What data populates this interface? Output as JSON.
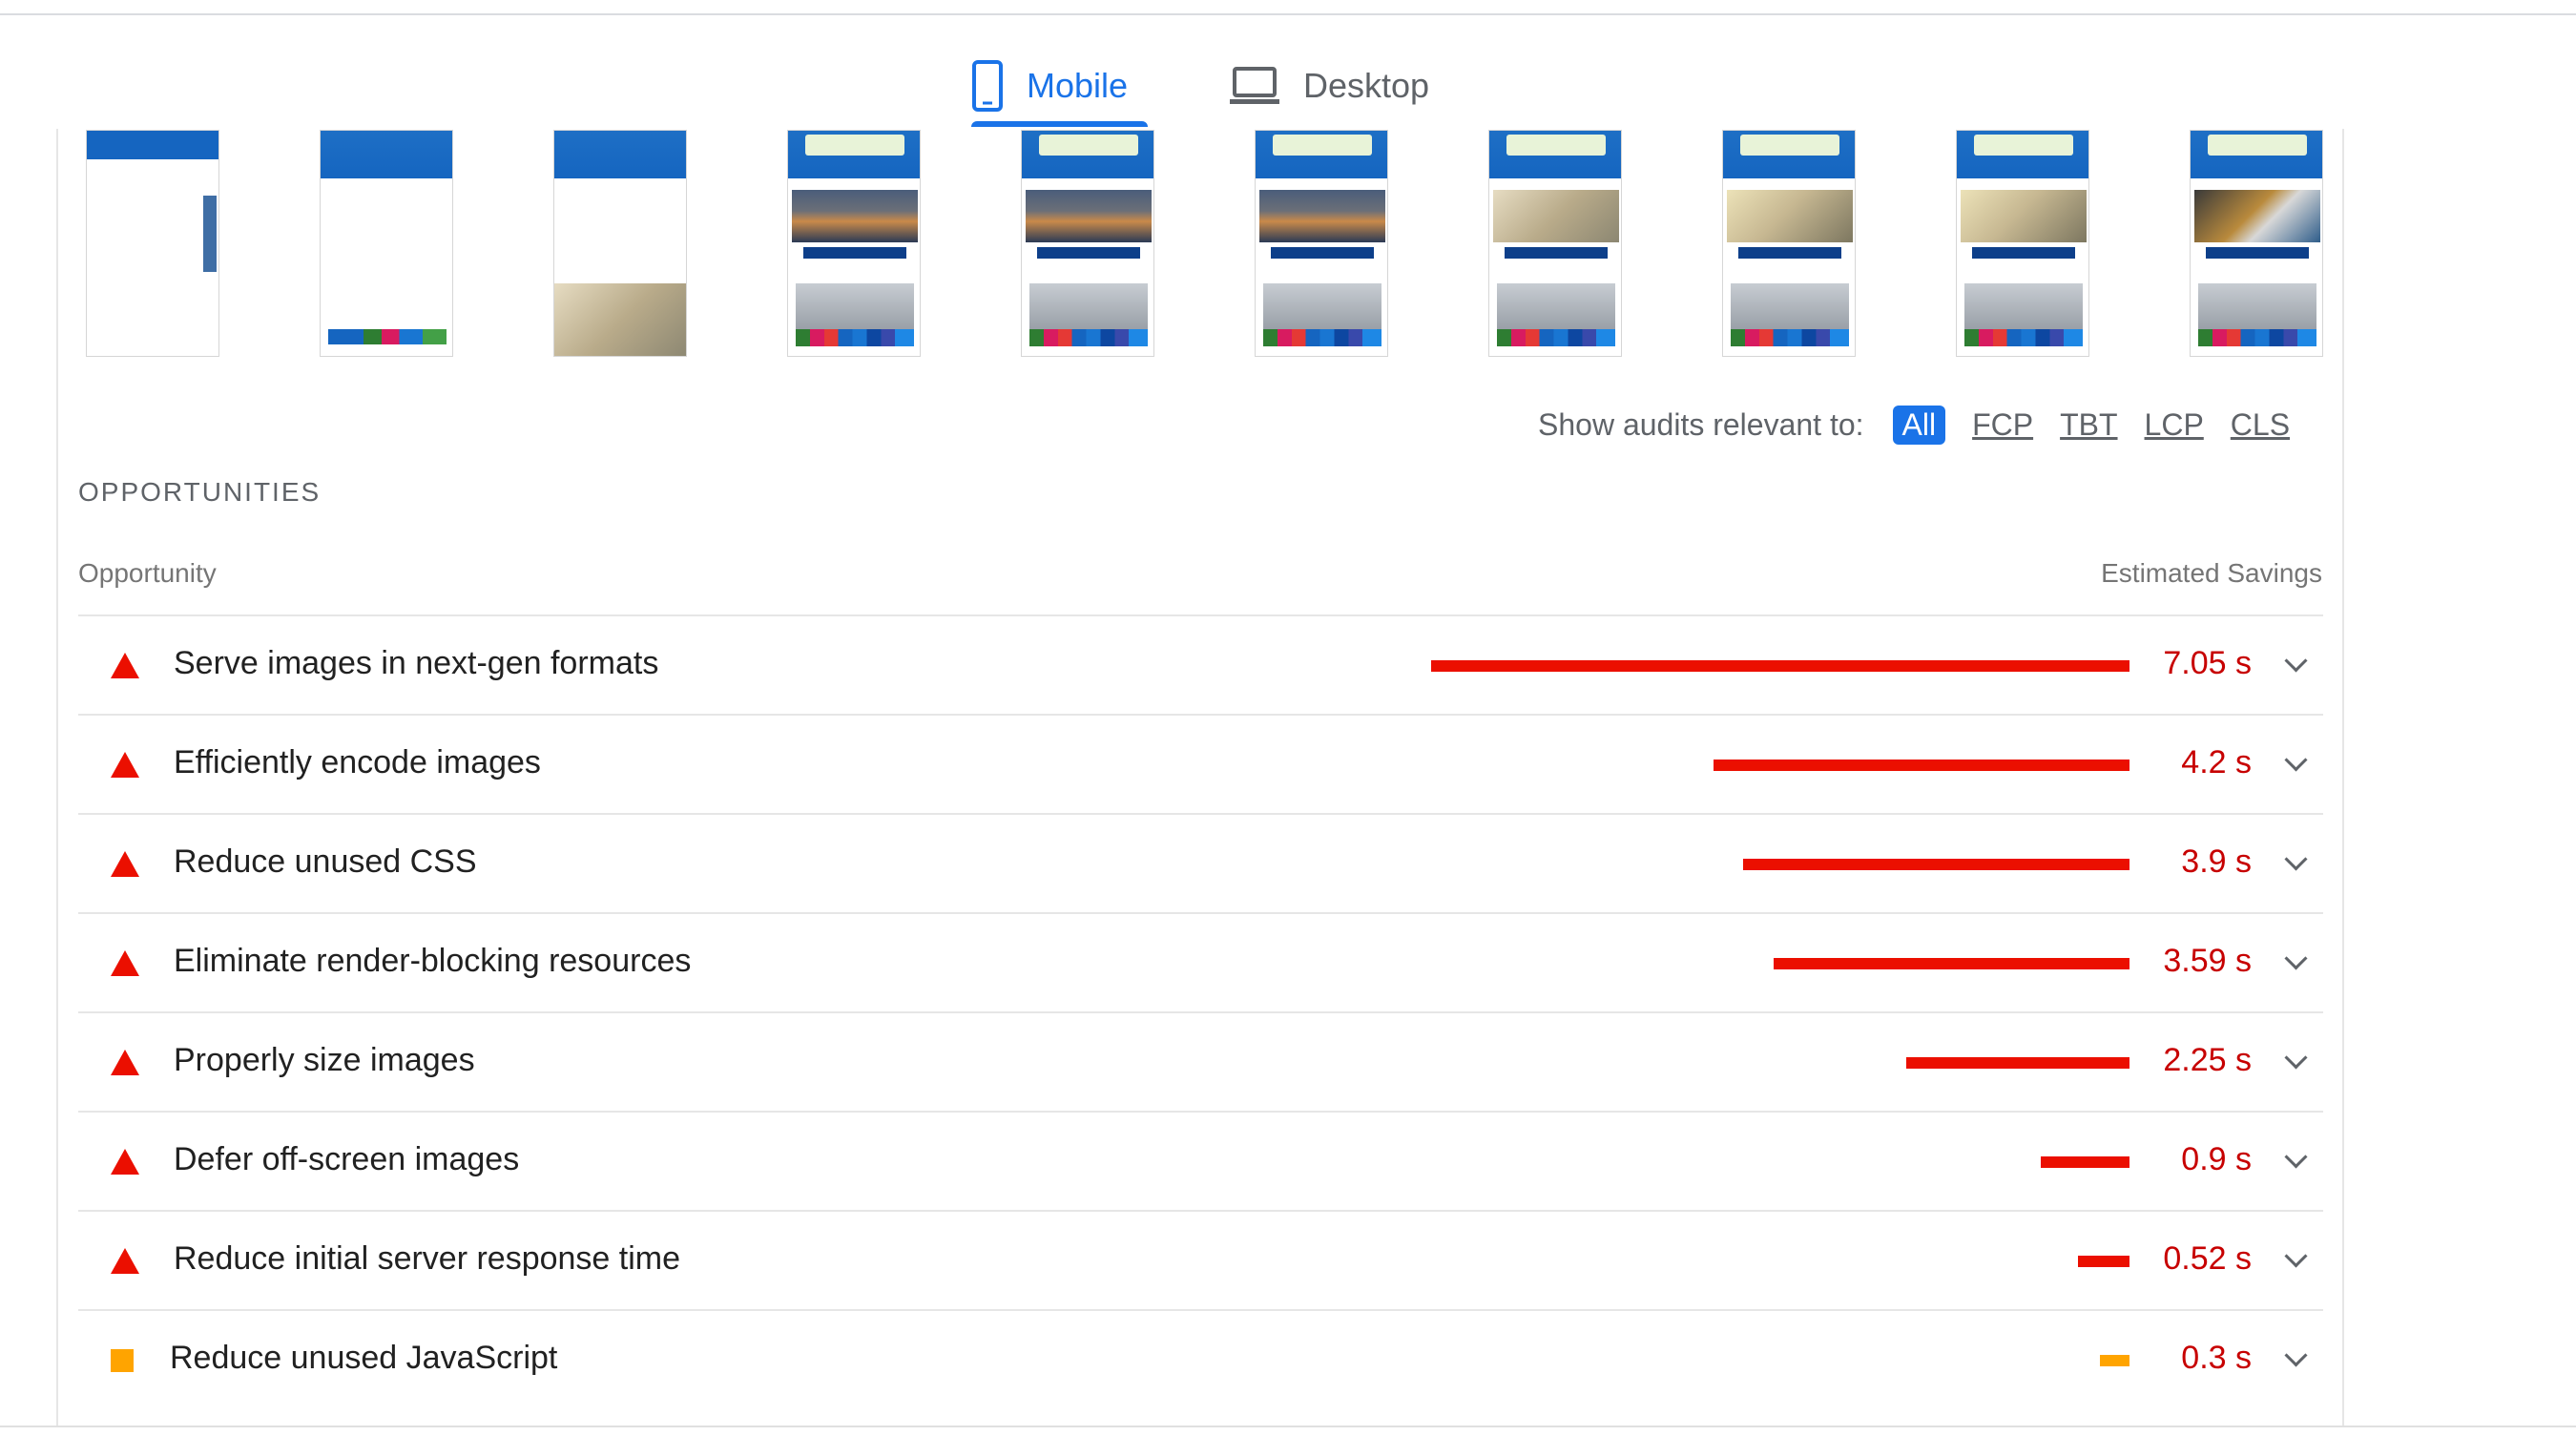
{
  "tabs": [
    {
      "label": "Mobile",
      "icon": "mobile-phone-icon",
      "active": true
    },
    {
      "label": "Desktop",
      "icon": "laptop-icon",
      "active": false
    }
  ],
  "filmstrip": {
    "frames": 10
  },
  "filter": {
    "label": "Show audits relevant to:",
    "chips": [
      "All",
      "FCP",
      "TBT",
      "LCP",
      "CLS"
    ],
    "active": "All"
  },
  "section": {
    "title": "OPPORTUNITIES",
    "col_opportunity": "Opportunity",
    "col_savings": "Estimated Savings"
  },
  "opportunities": [
    {
      "title": "Serve images in next-gen formats",
      "savings": "7.05 s",
      "seconds": 7.05,
      "severity": "fail"
    },
    {
      "title": "Efficiently encode images",
      "savings": "4.2 s",
      "seconds": 4.2,
      "severity": "fail"
    },
    {
      "title": "Reduce unused CSS",
      "savings": "3.9 s",
      "seconds": 3.9,
      "severity": "fail"
    },
    {
      "title": "Eliminate render-blocking resources",
      "savings": "3.59 s",
      "seconds": 3.59,
      "severity": "fail"
    },
    {
      "title": "Properly size images",
      "savings": "2.25 s",
      "seconds": 2.25,
      "severity": "fail"
    },
    {
      "title": "Defer off-screen images",
      "savings": "0.9 s",
      "seconds": 0.9,
      "severity": "fail"
    },
    {
      "title": "Reduce initial server response time",
      "savings": "0.52 s",
      "seconds": 0.52,
      "severity": "fail"
    },
    {
      "title": "Reduce unused JavaScript",
      "savings": "0.3 s",
      "seconds": 0.3,
      "severity": "average"
    }
  ],
  "colors": {
    "accent": "#1a73e8",
    "fail": "#eb0f00",
    "average": "#ffa400",
    "fail_text": "#c70000"
  }
}
